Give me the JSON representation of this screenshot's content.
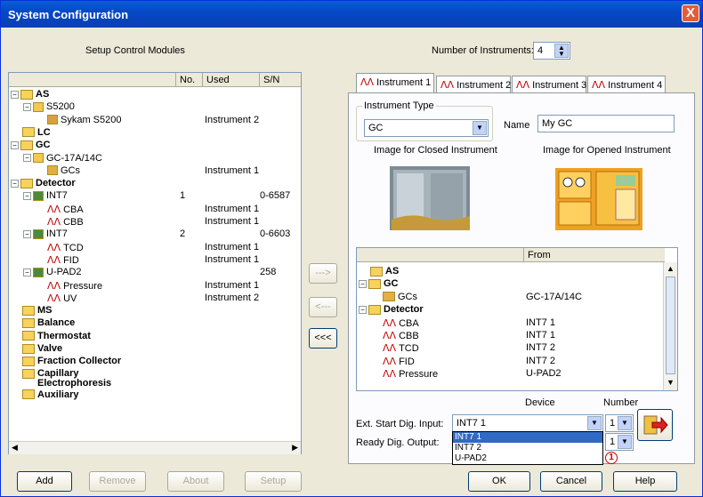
{
  "window": {
    "title": "System Configuration",
    "close": "X"
  },
  "left": {
    "heading": "Setup Control Modules",
    "columns": [
      "No.",
      "Used",
      "S/N"
    ],
    "rows": [
      {
        "label": "AS",
        "no": "",
        "used": "",
        "sn": ""
      },
      {
        "label": "S5200",
        "no": "",
        "used": "",
        "sn": ""
      },
      {
        "label": "Sykam S5200",
        "no": "",
        "used": "Instrument 2",
        "sn": ""
      },
      {
        "label": "LC",
        "no": "",
        "used": "",
        "sn": ""
      },
      {
        "label": "GC",
        "no": "",
        "used": "",
        "sn": ""
      },
      {
        "label": "GC-17A/14C",
        "no": "",
        "used": "",
        "sn": ""
      },
      {
        "label": "GCs",
        "no": "",
        "used": "Instrument 1",
        "sn": ""
      },
      {
        "label": "Detector",
        "no": "",
        "used": "",
        "sn": ""
      },
      {
        "label": "INT7",
        "no": "1",
        "used": "",
        "sn": "0-6587"
      },
      {
        "label": "CBA",
        "no": "",
        "used": "Instrument 1",
        "sn": ""
      },
      {
        "label": "CBB",
        "no": "",
        "used": "Instrument 1",
        "sn": ""
      },
      {
        "label": "INT7",
        "no": "2",
        "used": "",
        "sn": "0-6603"
      },
      {
        "label": "TCD",
        "no": "",
        "used": "Instrument 1",
        "sn": ""
      },
      {
        "label": "FID",
        "no": "",
        "used": "Instrument 1",
        "sn": ""
      },
      {
        "label": "U-PAD2",
        "no": "",
        "used": "",
        "sn": "258"
      },
      {
        "label": "Pressure",
        "no": "",
        "used": "Instrument 1",
        "sn": ""
      },
      {
        "label": "UV",
        "no": "",
        "used": "Instrument 2",
        "sn": ""
      },
      {
        "label": "MS",
        "no": "",
        "used": "",
        "sn": ""
      },
      {
        "label": "Balance",
        "no": "",
        "used": "",
        "sn": ""
      },
      {
        "label": "Thermostat",
        "no": "",
        "used": "",
        "sn": ""
      },
      {
        "label": "Valve",
        "no": "",
        "used": "",
        "sn": ""
      },
      {
        "label": "Fraction Collector",
        "no": "",
        "used": "",
        "sn": ""
      },
      {
        "label": "Capillary Electrophoresis",
        "no": "",
        "used": "",
        "sn": ""
      },
      {
        "label": "Auxiliary",
        "no": "",
        "used": "",
        "sn": ""
      }
    ]
  },
  "middle": {
    "add": "--->",
    "remove": "<---",
    "remove_all": "<<<"
  },
  "bottom": {
    "add": "Add",
    "remove": "Remove",
    "about": "About",
    "setup": "Setup",
    "ok": "OK",
    "cancel": "Cancel",
    "help": "Help"
  },
  "right": {
    "num_instruments_label": "Number of Instruments:",
    "num_instruments": "4",
    "tabs": [
      "Instrument 1",
      "Instrument 2",
      "Instrument 3",
      "Instrument 4"
    ],
    "instrument_type_label": "Instrument Type",
    "instrument_type": "GC",
    "name_label": "Name",
    "name_value": "My GC",
    "closed_img_label": "Image for Closed Instrument",
    "opened_img_label": "Image for Opened Instrument",
    "list_col_from": "From",
    "list": [
      {
        "label": "AS",
        "from": ""
      },
      {
        "label": "GC",
        "from": ""
      },
      {
        "label": "GCs",
        "from": "GC-17A/14C"
      },
      {
        "label": "Detector",
        "from": ""
      },
      {
        "label": "CBA",
        "from": "INT7 1"
      },
      {
        "label": "CBB",
        "from": "INT7 1"
      },
      {
        "label": "TCD",
        "from": "INT7 2"
      },
      {
        "label": "FID",
        "from": "INT7 2"
      },
      {
        "label": "Pressure",
        "from": "U-PAD2"
      }
    ],
    "device_header": "Device",
    "number_header": "Number",
    "ext_start_label": "Ext. Start Dig. Input:",
    "ext_start_value": "INT7 1",
    "ext_start_number": "1",
    "ready_label": "Ready Dig. Output:",
    "ready_number": "1",
    "dropdown_options": [
      "INT7 1",
      "INT7 2",
      "U-PAD2"
    ],
    "callout": "1"
  }
}
